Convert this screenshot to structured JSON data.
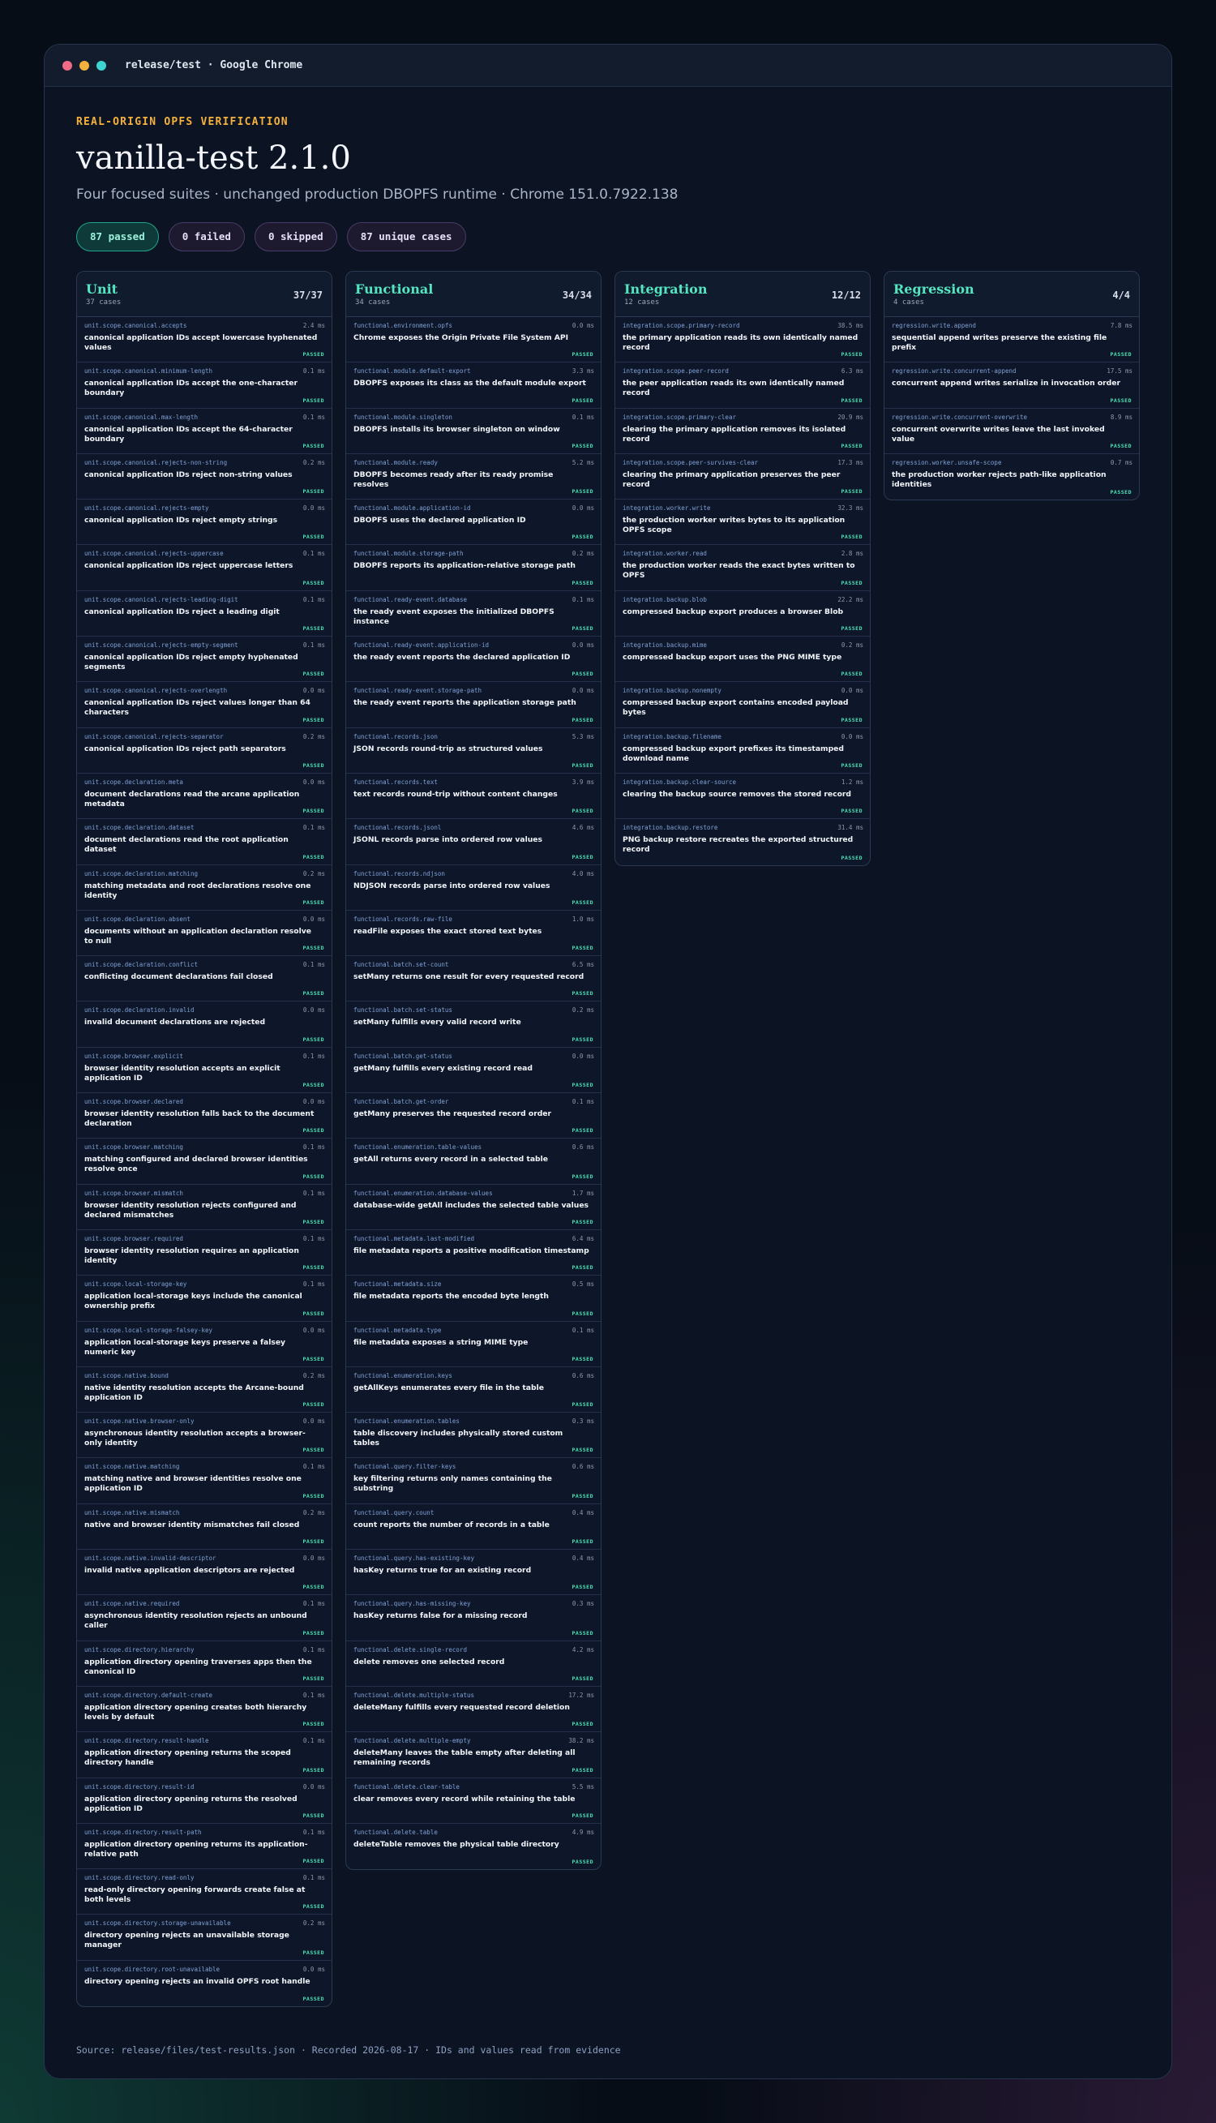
{
  "window": {
    "title": "release/test · Google Chrome"
  },
  "header": {
    "eyebrow": "REAL-ORIGIN OPFS VERIFICATION",
    "title": "vanilla-test 2.1.0",
    "subtitle": "Four focused suites · unchanged production DBOPFS runtime · Chrome 151.0.7922.138"
  },
  "badges": {
    "passed": "87 passed",
    "failed": "0 failed",
    "skipped": "0 skipped",
    "unique": "87 unique cases"
  },
  "colors": {
    "accent": "#54e6c1",
    "eyebrow": "#f5b13d",
    "passed": "#49e0b5"
  },
  "suites": [
    {
      "title": "Unit",
      "count": "37 cases",
      "ratio": "37/37",
      "cases": [
        {
          "id": "unit.scope.canonical.accepts",
          "ms": "2.4 ms",
          "name": "canonical application IDs accept lowercase hyphenated values",
          "status": "PASSED"
        },
        {
          "id": "unit.scope.canonical.minimum-length",
          "ms": "0.1 ms",
          "name": "canonical application IDs accept the one-character boundary",
          "status": "PASSED"
        },
        {
          "id": "unit.scope.canonical.max-length",
          "ms": "0.1 ms",
          "name": "canonical application IDs accept the 64-character boundary",
          "status": "PASSED"
        },
        {
          "id": "unit.scope.canonical.rejects-non-string",
          "ms": "0.2 ms",
          "name": "canonical application IDs reject non-string values",
          "status": "PASSED"
        },
        {
          "id": "unit.scope.canonical.rejects-empty",
          "ms": "0.0 ms",
          "name": "canonical application IDs reject empty strings",
          "status": "PASSED"
        },
        {
          "id": "unit.scope.canonical.rejects-uppercase",
          "ms": "0.1 ms",
          "name": "canonical application IDs reject uppercase letters",
          "status": "PASSED"
        },
        {
          "id": "unit.scope.canonical.rejects-leading-digit",
          "ms": "0.1 ms",
          "name": "canonical application IDs reject a leading digit",
          "status": "PASSED"
        },
        {
          "id": "unit.scope.canonical.rejects-empty-segment",
          "ms": "0.1 ms",
          "name": "canonical application IDs reject empty hyphenated segments",
          "status": "PASSED"
        },
        {
          "id": "unit.scope.canonical.rejects-overlength",
          "ms": "0.0 ms",
          "name": "canonical application IDs reject values longer than 64 characters",
          "status": "PASSED"
        },
        {
          "id": "unit.scope.canonical.rejects-separator",
          "ms": "0.2 ms",
          "name": "canonical application IDs reject path separators",
          "status": "PASSED"
        },
        {
          "id": "unit.scope.declaration.meta",
          "ms": "0.0 ms",
          "name": "document declarations read the arcane application metadata",
          "status": "PASSED"
        },
        {
          "id": "unit.scope.declaration.dataset",
          "ms": "0.1 ms",
          "name": "document declarations read the root application dataset",
          "status": "PASSED"
        },
        {
          "id": "unit.scope.declaration.matching",
          "ms": "0.2 ms",
          "name": "matching metadata and root declarations resolve one identity",
          "status": "PASSED"
        },
        {
          "id": "unit.scope.declaration.absent",
          "ms": "0.0 ms",
          "name": "documents without an application declaration resolve to null",
          "status": "PASSED"
        },
        {
          "id": "unit.scope.declaration.conflict",
          "ms": "0.1 ms",
          "name": "conflicting document declarations fail closed",
          "status": "PASSED"
        },
        {
          "id": "unit.scope.declaration.invalid",
          "ms": "0.0 ms",
          "name": "invalid document declarations are rejected",
          "status": "PASSED"
        },
        {
          "id": "unit.scope.browser.explicit",
          "ms": "0.1 ms",
          "name": "browser identity resolution accepts an explicit application ID",
          "status": "PASSED"
        },
        {
          "id": "unit.scope.browser.declared",
          "ms": "0.0 ms",
          "name": "browser identity resolution falls back to the document declaration",
          "status": "PASSED"
        },
        {
          "id": "unit.scope.browser.matching",
          "ms": "0.1 ms",
          "name": "matching configured and declared browser identities resolve once",
          "status": "PASSED"
        },
        {
          "id": "unit.scope.browser.mismatch",
          "ms": "0.1 ms",
          "name": "browser identity resolution rejects configured and declared mismatches",
          "status": "PASSED"
        },
        {
          "id": "unit.scope.browser.required",
          "ms": "0.1 ms",
          "name": "browser identity resolution requires an application identity",
          "status": "PASSED"
        },
        {
          "id": "unit.scope.local-storage-key",
          "ms": "0.1 ms",
          "name": "application local-storage keys include the canonical ownership prefix",
          "status": "PASSED"
        },
        {
          "id": "unit.scope.local-storage-falsey-key",
          "ms": "0.0 ms",
          "name": "application local-storage keys preserve a falsey numeric key",
          "status": "PASSED"
        },
        {
          "id": "unit.scope.native.bound",
          "ms": "0.2 ms",
          "name": "native identity resolution accepts the Arcane-bound application ID",
          "status": "PASSED"
        },
        {
          "id": "unit.scope.native.browser-only",
          "ms": "0.0 ms",
          "name": "asynchronous identity resolution accepts a browser-only identity",
          "status": "PASSED"
        },
        {
          "id": "unit.scope.native.matching",
          "ms": "0.1 ms",
          "name": "matching native and browser identities resolve one application ID",
          "status": "PASSED"
        },
        {
          "id": "unit.scope.native.mismatch",
          "ms": "0.2 ms",
          "name": "native and browser identity mismatches fail closed",
          "status": "PASSED"
        },
        {
          "id": "unit.scope.native.invalid-descriptor",
          "ms": "0.0 ms",
          "name": "invalid native application descriptors are rejected",
          "status": "PASSED"
        },
        {
          "id": "unit.scope.native.required",
          "ms": "0.1 ms",
          "name": "asynchronous identity resolution rejects an unbound caller",
          "status": "PASSED"
        },
        {
          "id": "unit.scope.directory.hierarchy",
          "ms": "0.1 ms",
          "name": "application directory opening traverses apps then the canonical ID",
          "status": "PASSED"
        },
        {
          "id": "unit.scope.directory.default-create",
          "ms": "0.1 ms",
          "name": "application directory opening creates both hierarchy levels by default",
          "status": "PASSED"
        },
        {
          "id": "unit.scope.directory.result-handle",
          "ms": "0.1 ms",
          "name": "application directory opening returns the scoped directory handle",
          "status": "PASSED"
        },
        {
          "id": "unit.scope.directory.result-id",
          "ms": "0.0 ms",
          "name": "application directory opening returns the resolved application ID",
          "status": "PASSED"
        },
        {
          "id": "unit.scope.directory.result-path",
          "ms": "0.1 ms",
          "name": "application directory opening returns its application-relative path",
          "status": "PASSED"
        },
        {
          "id": "unit.scope.directory.read-only",
          "ms": "0.1 ms",
          "name": "read-only directory opening forwards create false at both levels",
          "status": "PASSED"
        },
        {
          "id": "unit.scope.directory.storage-unavailable",
          "ms": "0.2 ms",
          "name": "directory opening rejects an unavailable storage manager",
          "status": "PASSED"
        },
        {
          "id": "unit.scope.directory.root-unavailable",
          "ms": "0.0 ms",
          "name": "directory opening rejects an invalid OPFS root handle",
          "status": "PASSED"
        }
      ]
    },
    {
      "title": "Functional",
      "count": "34 cases",
      "ratio": "34/34",
      "cases": [
        {
          "id": "functional.environment.opfs",
          "ms": "0.0 ms",
          "name": "Chrome exposes the Origin Private File System API",
          "status": "PASSED"
        },
        {
          "id": "functional.module.default-export",
          "ms": "3.3 ms",
          "name": "DBOPFS exposes its class as the default module export",
          "status": "PASSED"
        },
        {
          "id": "functional.module.singleton",
          "ms": "0.1 ms",
          "name": "DBOPFS installs its browser singleton on window",
          "status": "PASSED"
        },
        {
          "id": "functional.module.ready",
          "ms": "5.2 ms",
          "name": "DBOPFS becomes ready after its ready promise resolves",
          "status": "PASSED"
        },
        {
          "id": "functional.module.application-id",
          "ms": "0.0 ms",
          "name": "DBOPFS uses the declared application ID",
          "status": "PASSED"
        },
        {
          "id": "functional.module.storage-path",
          "ms": "0.2 ms",
          "name": "DBOPFS reports its application-relative storage path",
          "status": "PASSED"
        },
        {
          "id": "functional.ready-event.database",
          "ms": "0.1 ms",
          "name": "the ready event exposes the initialized DBOPFS instance",
          "status": "PASSED"
        },
        {
          "id": "functional.ready-event.application-id",
          "ms": "0.0 ms",
          "name": "the ready event reports the declared application ID",
          "status": "PASSED"
        },
        {
          "id": "functional.ready-event.storage-path",
          "ms": "0.0 ms",
          "name": "the ready event reports the application storage path",
          "status": "PASSED"
        },
        {
          "id": "functional.records.json",
          "ms": "5.3 ms",
          "name": "JSON records round-trip as structured values",
          "status": "PASSED"
        },
        {
          "id": "functional.records.text",
          "ms": "3.9 ms",
          "name": "text records round-trip without content changes",
          "status": "PASSED"
        },
        {
          "id": "functional.records.jsonl",
          "ms": "4.6 ms",
          "name": "JSONL records parse into ordered row values",
          "status": "PASSED"
        },
        {
          "id": "functional.records.ndjson",
          "ms": "4.0 ms",
          "name": "NDJSON records parse into ordered row values",
          "status": "PASSED"
        },
        {
          "id": "functional.records.raw-file",
          "ms": "1.0 ms",
          "name": "readFile exposes the exact stored text bytes",
          "status": "PASSED"
        },
        {
          "id": "functional.batch.set-count",
          "ms": "6.5 ms",
          "name": "setMany returns one result for every requested record",
          "status": "PASSED"
        },
        {
          "id": "functional.batch.set-status",
          "ms": "0.2 ms",
          "name": "setMany fulfills every valid record write",
          "status": "PASSED"
        },
        {
          "id": "functional.batch.get-status",
          "ms": "0.0 ms",
          "name": "getMany fulfills every existing record read",
          "status": "PASSED"
        },
        {
          "id": "functional.batch.get-order",
          "ms": "0.1 ms",
          "name": "getMany preserves the requested record order",
          "status": "PASSED"
        },
        {
          "id": "functional.enumeration.table-values",
          "ms": "0.6 ms",
          "name": "getAll returns every record in a selected table",
          "status": "PASSED"
        },
        {
          "id": "functional.enumeration.database-values",
          "ms": "1.7 ms",
          "name": "database-wide getAll includes the selected table values",
          "status": "PASSED"
        },
        {
          "id": "functional.metadata.last-modified",
          "ms": "6.4 ms",
          "name": "file metadata reports a positive modification timestamp",
          "status": "PASSED"
        },
        {
          "id": "functional.metadata.size",
          "ms": "0.5 ms",
          "name": "file metadata reports the encoded byte length",
          "status": "PASSED"
        },
        {
          "id": "functional.metadata.type",
          "ms": "0.1 ms",
          "name": "file metadata exposes a string MIME type",
          "status": "PASSED"
        },
        {
          "id": "functional.enumeration.keys",
          "ms": "0.6 ms",
          "name": "getAllKeys enumerates every file in the table",
          "status": "PASSED"
        },
        {
          "id": "functional.enumeration.tables",
          "ms": "0.3 ms",
          "name": "table discovery includes physically stored custom tables",
          "status": "PASSED"
        },
        {
          "id": "functional.query.filter-keys",
          "ms": "0.6 ms",
          "name": "key filtering returns only names containing the substring",
          "status": "PASSED"
        },
        {
          "id": "functional.query.count",
          "ms": "0.4 ms",
          "name": "count reports the number of records in a table",
          "status": "PASSED"
        },
        {
          "id": "functional.query.has-existing-key",
          "ms": "0.4 ms",
          "name": "hasKey returns true for an existing record",
          "status": "PASSED"
        },
        {
          "id": "functional.query.has-missing-key",
          "ms": "0.3 ms",
          "name": "hasKey returns false for a missing record",
          "status": "PASSED"
        },
        {
          "id": "functional.delete.single-record",
          "ms": "4.2 ms",
          "name": "delete removes one selected record",
          "status": "PASSED"
        },
        {
          "id": "functional.delete.multiple-status",
          "ms": "17.2 ms",
          "name": "deleteMany fulfills every requested record deletion",
          "status": "PASSED"
        },
        {
          "id": "functional.delete.multiple-empty",
          "ms": "38.2 ms",
          "name": "deleteMany leaves the table empty after deleting all remaining records",
          "status": "PASSED"
        },
        {
          "id": "functional.delete.clear-table",
          "ms": "5.5 ms",
          "name": "clear removes every record while retaining the table",
          "status": "PASSED"
        },
        {
          "id": "functional.delete.table",
          "ms": "4.9 ms",
          "name": "deleteTable removes the physical table directory",
          "status": "PASSED"
        }
      ]
    },
    {
      "title": "Integration",
      "count": "12 cases",
      "ratio": "12/12",
      "cases": [
        {
          "id": "integration.scope.primary-record",
          "ms": "38.5 ms",
          "name": "the primary application reads its own identically named record",
          "status": "PASSED"
        },
        {
          "id": "integration.scope.peer-record",
          "ms": "6.3 ms",
          "name": "the peer application reads its own identically named record",
          "status": "PASSED"
        },
        {
          "id": "integration.scope.primary-clear",
          "ms": "20.9 ms",
          "name": "clearing the primary application removes its isolated record",
          "status": "PASSED"
        },
        {
          "id": "integration.scope.peer-survives-clear",
          "ms": "17.3 ms",
          "name": "clearing the primary application preserves the peer record",
          "status": "PASSED"
        },
        {
          "id": "integration.worker.write",
          "ms": "32.3 ms",
          "name": "the production worker writes bytes to its application OPFS scope",
          "status": "PASSED"
        },
        {
          "id": "integration.worker.read",
          "ms": "2.8 ms",
          "name": "the production worker reads the exact bytes written to OPFS",
          "status": "PASSED"
        },
        {
          "id": "integration.backup.blob",
          "ms": "22.2 ms",
          "name": "compressed backup export produces a browser Blob",
          "status": "PASSED"
        },
        {
          "id": "integration.backup.mime",
          "ms": "0.2 ms",
          "name": "compressed backup export uses the PNG MIME type",
          "status": "PASSED"
        },
        {
          "id": "integration.backup.nonempty",
          "ms": "0.0 ms",
          "name": "compressed backup export contains encoded payload bytes",
          "status": "PASSED"
        },
        {
          "id": "integration.backup.filename",
          "ms": "0.0 ms",
          "name": "compressed backup export prefixes its timestamped download name",
          "status": "PASSED"
        },
        {
          "id": "integration.backup.clear-source",
          "ms": "1.2 ms",
          "name": "clearing the backup source removes the stored record",
          "status": "PASSED"
        },
        {
          "id": "integration.backup.restore",
          "ms": "31.4 ms",
          "name": "PNG backup restore recreates the exported structured record",
          "status": "PASSED"
        }
      ]
    },
    {
      "title": "Regression",
      "count": "4 cases",
      "ratio": "4/4",
      "cases": [
        {
          "id": "regression.write.append",
          "ms": "7.8 ms",
          "name": "sequential append writes preserve the existing file prefix",
          "status": "PASSED"
        },
        {
          "id": "regression.write.concurrent-append",
          "ms": "17.5 ms",
          "name": "concurrent append writes serialize in invocation order",
          "status": "PASSED"
        },
        {
          "id": "regression.write.concurrent-overwrite",
          "ms": "8.9 ms",
          "name": "concurrent overwrite writes leave the last invoked value",
          "status": "PASSED"
        },
        {
          "id": "regression.worker.unsafe-scope",
          "ms": "0.7 ms",
          "name": "the production worker rejects path-like application identities",
          "status": "PASSED"
        }
      ]
    }
  ],
  "footer": {
    "text": "Source: release/files/test-results.json · Recorded 2026-08-17 · IDs and values read from evidence"
  }
}
